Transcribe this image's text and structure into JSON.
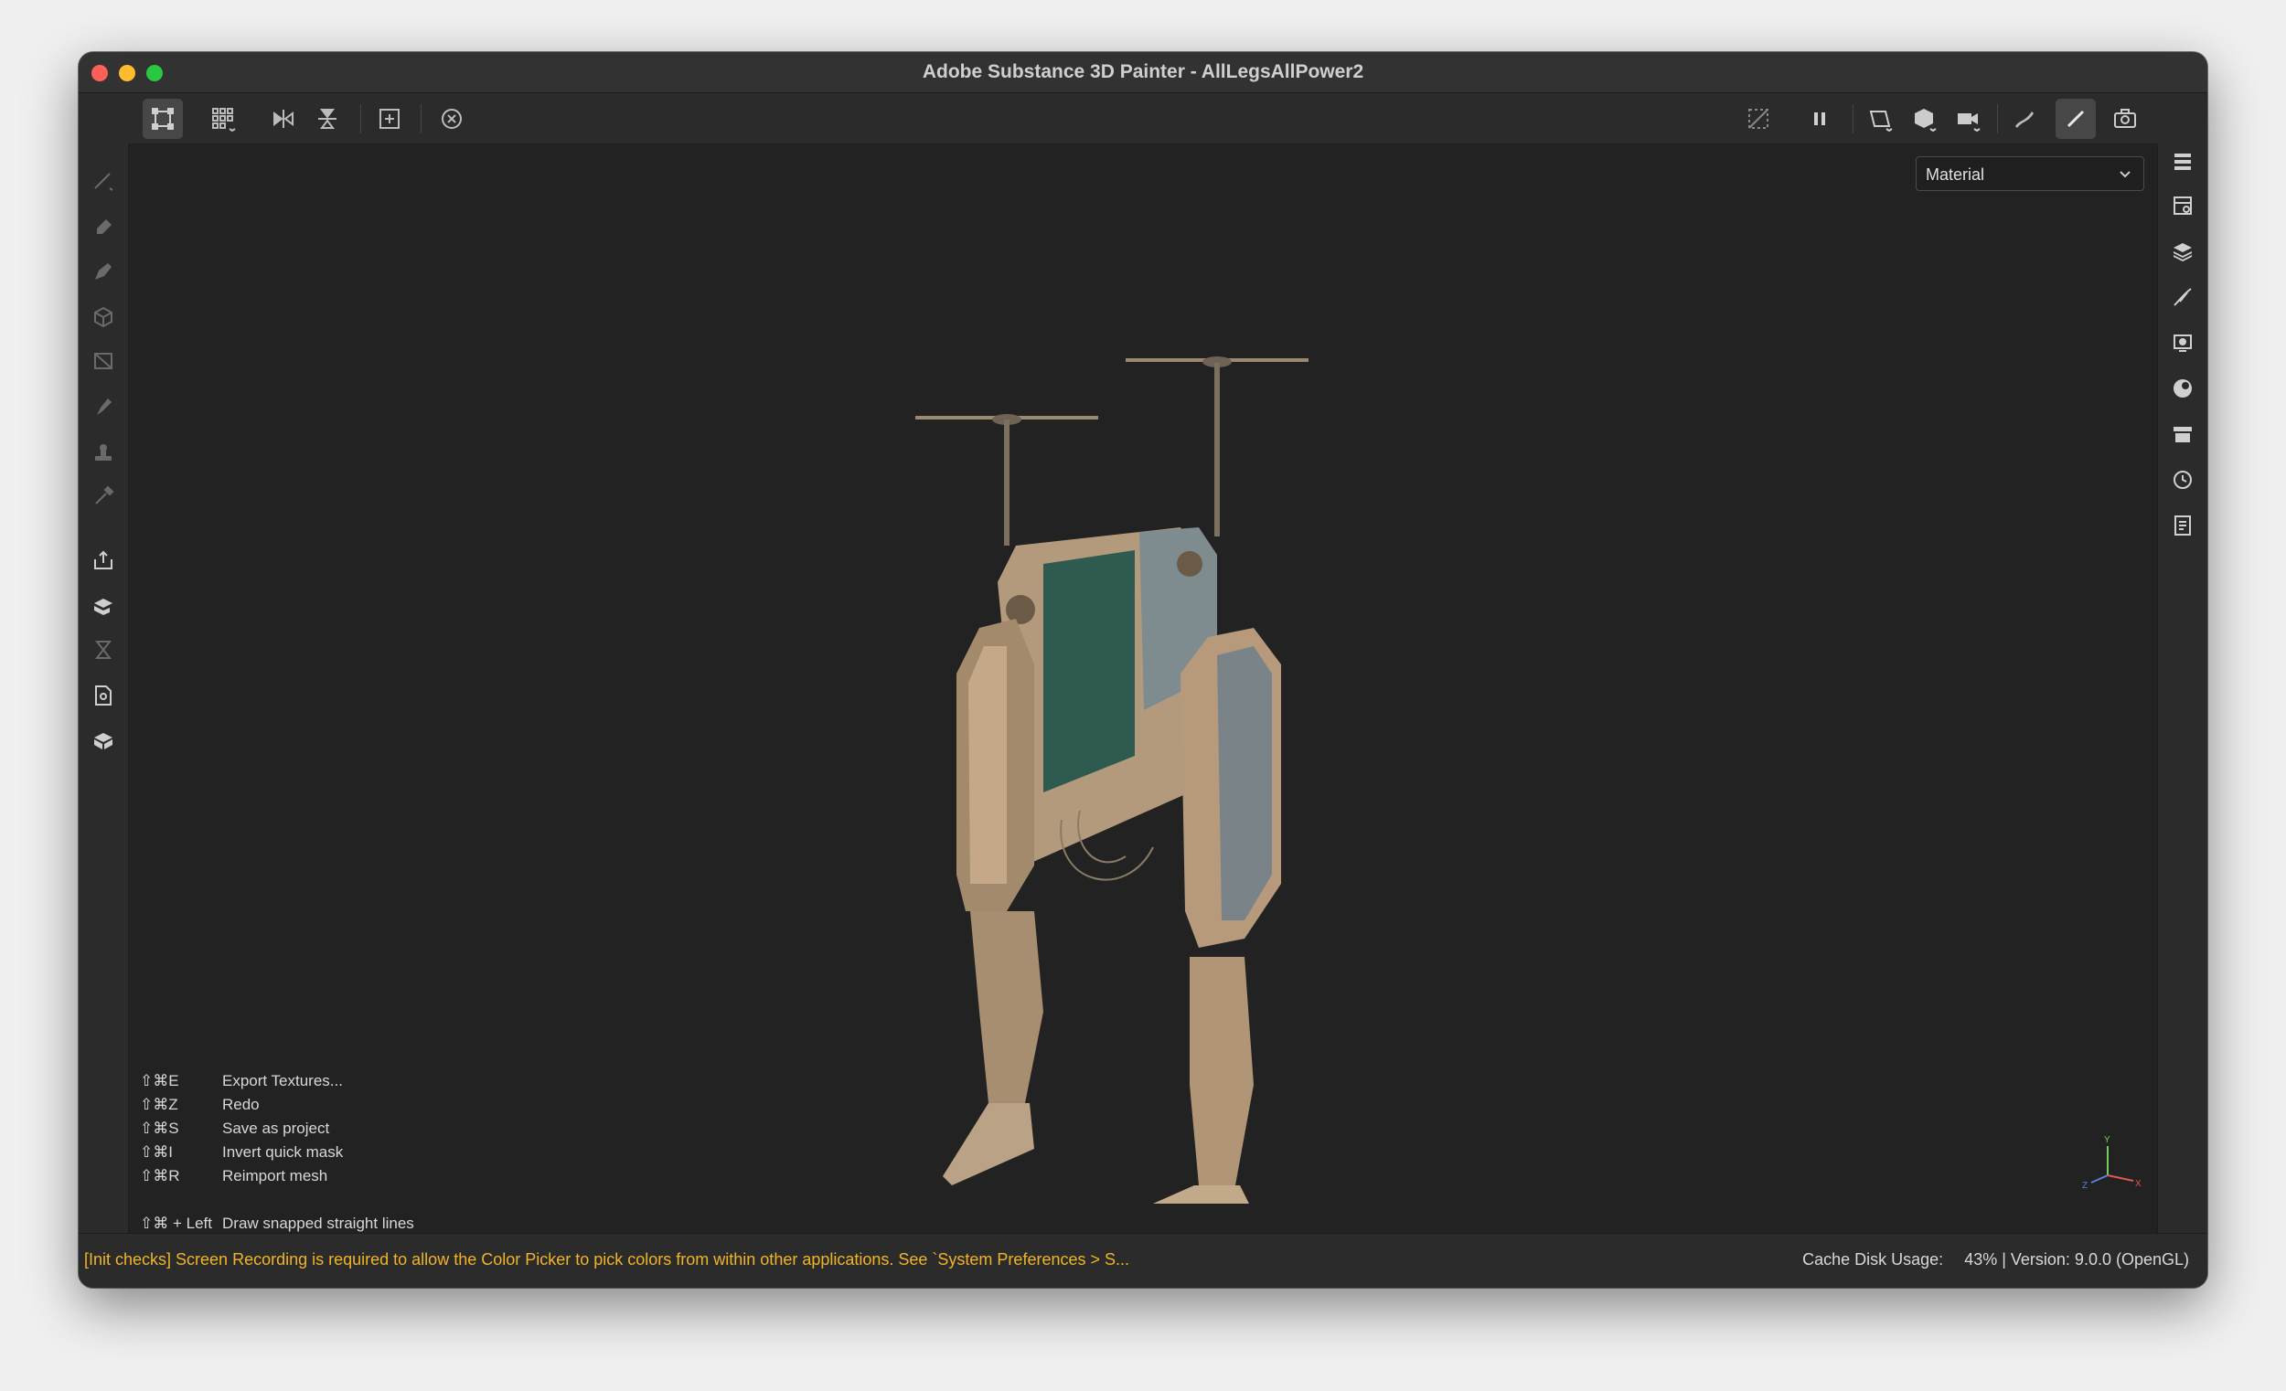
{
  "window": {
    "title": "Adobe Substance 3D Painter - AllLegsAllPower2"
  },
  "toolbar": {
    "left_icons": [
      "bounding-box-icon",
      "grid-icon",
      "mirror-x-icon",
      "mirror-y-icon",
      "frame-icon",
      "reset-view-icon"
    ],
    "right_icons": [
      "hide-overlay-icon",
      "pause-icon",
      "viewport-2d-icon",
      "viewport-3d-icon",
      "camera-icon",
      "dynamic-stroke-icon",
      "paint-brush-icon",
      "screenshot-icon"
    ]
  },
  "left_tools": [
    "paint-icon",
    "eraser-icon",
    "projection-icon",
    "geometry-fill-icon",
    "polygon-fill-icon",
    "smudge-icon",
    "clone-icon",
    "color-picker-icon",
    "export-icon",
    "bake-icon",
    "hourglass-icon",
    "document-settings-icon",
    "mesh-icon"
  ],
  "right_panels": [
    "layers-stack-icon",
    "texture-set-settings-icon",
    "layers-icon",
    "properties-icon",
    "display-settings-icon",
    "shader-settings-icon",
    "assets-icon",
    "history-icon",
    "log-icon"
  ],
  "viewport": {
    "mode_select": "Material"
  },
  "shortcuts": [
    {
      "key": "⇧⌘E",
      "label": "Export Textures..."
    },
    {
      "key": "⇧⌘Z",
      "label": "Redo"
    },
    {
      "key": "⇧⌘S",
      "label": "Save as project"
    },
    {
      "key": "⇧⌘I",
      "label": "Invert quick mask"
    },
    {
      "key": "⇧⌘R",
      "label": "Reimport mesh"
    }
  ],
  "shortcut_extra": {
    "key": "⇧⌘ + Left",
    "label": "Draw snapped straight lines"
  },
  "gizmo": {
    "x": "X",
    "y": "Y",
    "z": "Z"
  },
  "status": {
    "message": "[Init checks] Screen Recording is required to allow the Color Picker to pick colors from within other applications. See `System Preferences > S...",
    "cache_label": "Cache Disk Usage:",
    "cache_value": "43% | Version: 9.0.0 (OpenGL)"
  },
  "colors": {
    "warning": "#f0b429",
    "viewport_bg": "#222222",
    "chrome": "#2b2b2b"
  }
}
